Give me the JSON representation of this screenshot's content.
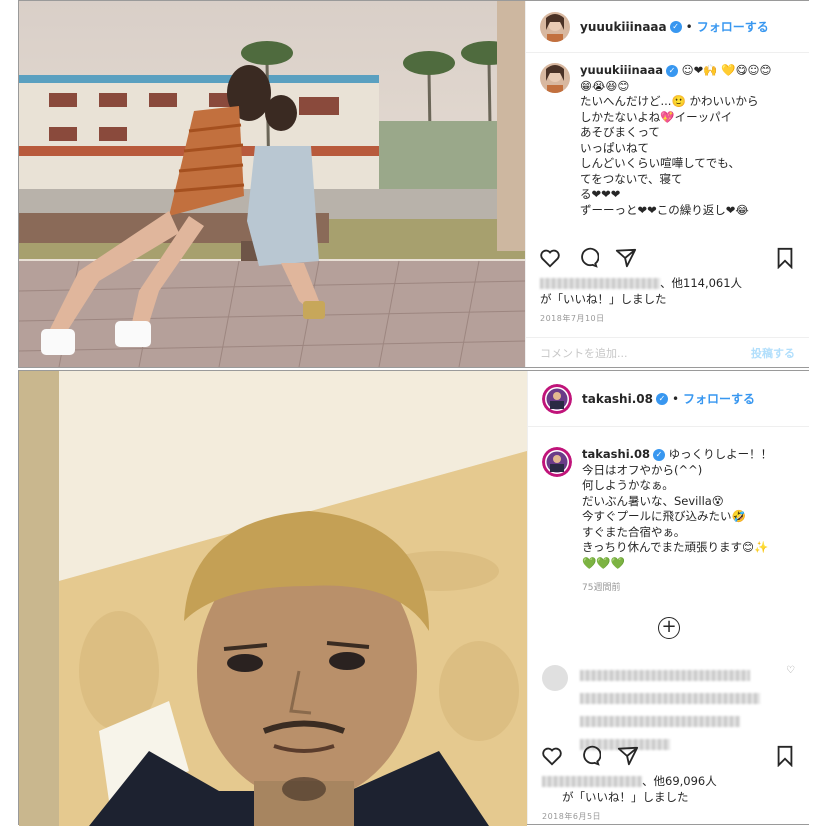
{
  "post1": {
    "username": "yuuukiiinaaa",
    "follow_label": "フォローする",
    "separator": "•",
    "caption_lines": [
      "☺❤🙌 💛😋☺😊",
      "😁😭😆😊",
      "たいへんだけど...🙂 かわいいから",
      "しかたないよね💖イーッパイ",
      "あそびまくって",
      "いっぱいねて",
      "しんどいくらい喧嘩してでも、",
      "てをつないで、寝て",
      "る❤❤❤",
      "ずーーっと❤❤この繰り返し❤😂"
    ],
    "likes_prefix": "、他114,061人",
    "likes_suffix": "が「いいね！」しました",
    "date": "2018年7月10日",
    "comment_placeholder": "コメントを追加...",
    "post_button": "投稿する"
  },
  "post2": {
    "username": "takashi.08",
    "follow_label": "フォローする",
    "separator": "•",
    "caption_lines": [
      "ゆっくりしよー！！",
      "今日はオフやから(^^)",
      "何しようかなぁ。",
      "だいぶん暑いな、Sevilla😵",
      "今すぐプールに飛び込みたい🤣",
      "すぐまた合宿やぁ。",
      "きっちり休んでまた頑張ります😊✨",
      "💚💚💚"
    ],
    "time_ago": "75週間前",
    "add_icon": "+",
    "likes_prefix": "、他69,096人",
    "likes_suffix": "が「いいね！」しました",
    "date": "2018年6月5日"
  },
  "icons": {
    "heart": "heart-icon",
    "comment": "comment-icon",
    "share": "share-icon",
    "save": "bookmark-icon"
  },
  "colors": {
    "follow": "#3897f0",
    "verified": "#3897f0",
    "border": "#efefef"
  }
}
